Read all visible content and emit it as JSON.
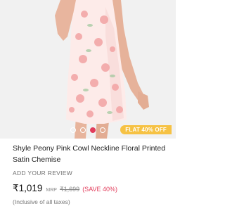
{
  "product": {
    "image_alt": "Shyle Peony Pink Cowl Neckline Floral Printed Satin Chemise",
    "carousel_dots": 4,
    "carousel_active": 2,
    "offer_badge": "FLAT 40% OFF",
    "title": "Shyle Peony Pink Cowl Neckline Floral Printed Satin Chemise",
    "review_link": "ADD YOUR REVIEW",
    "price": "₹1,019",
    "mrp_label": "MRP",
    "mrp": "₹1,699",
    "discount": "(SAVE 40%)",
    "tax_note": "(Inclusive of all taxes)"
  },
  "colors": {
    "accent": "#e23c5b",
    "badge": "#f6c244",
    "image_background": "#f1f1f1",
    "garment": "#fdeaea",
    "print": "#f2a0a0"
  }
}
